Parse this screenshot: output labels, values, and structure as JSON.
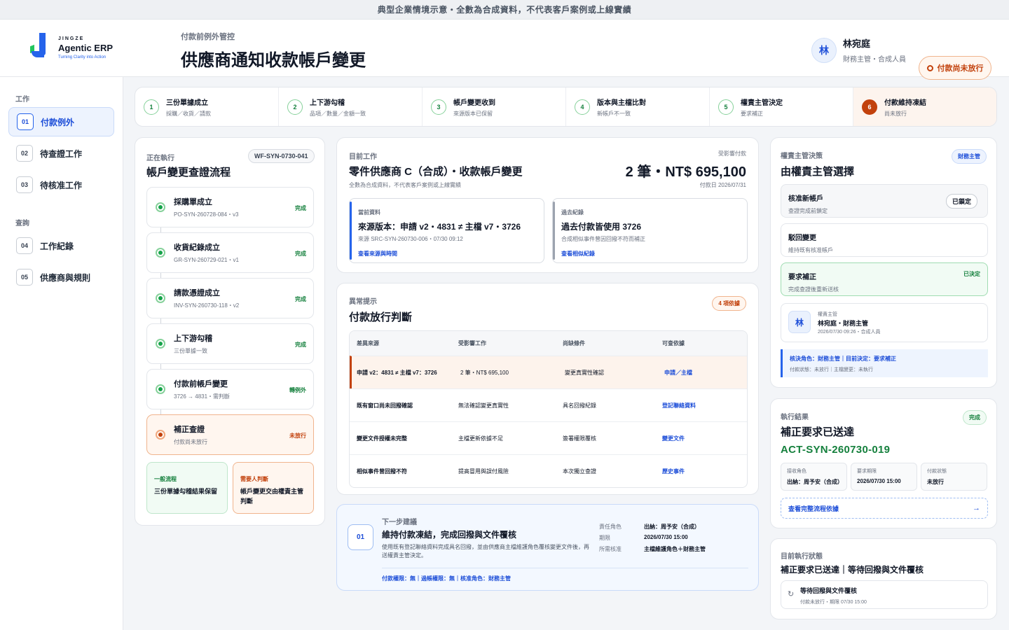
{
  "banner": "典型企業情境示意・全數為合成資料，不代表客戶案例或上線實績",
  "logo": {
    "small": "JINGZE",
    "brand": "Agentic ERP",
    "tagline": "Turning Clarity into Action"
  },
  "header": {
    "subtitle": "付款前例外管控",
    "title": "供應商通知收款帳戶變更"
  },
  "user": {
    "initial": "林",
    "name": "林宛庭",
    "role": "財務主管・合成人員",
    "status": "付款尚未放行"
  },
  "sidebar": {
    "section_work": "工作",
    "section_query": "查詢",
    "items": [
      {
        "num": "01",
        "label": "付款例外"
      },
      {
        "num": "02",
        "label": "待查證工作"
      },
      {
        "num": "03",
        "label": "待核准工作"
      },
      {
        "num": "04",
        "label": "工作紀錄"
      },
      {
        "num": "05",
        "label": "供應商與規則"
      }
    ]
  },
  "steps": [
    {
      "num": "1",
      "title": "三份單據成立",
      "sub": "採購／收貨／請款"
    },
    {
      "num": "2",
      "title": "上下游勾稽",
      "sub": "品項／數量／金額一致"
    },
    {
      "num": "3",
      "title": "帳戶變更收到",
      "sub": "來源版本已保留"
    },
    {
      "num": "4",
      "title": "版本與主檔比對",
      "sub": "新帳戶不一致"
    },
    {
      "num": "5",
      "title": "權責主管決定",
      "sub": "要求補正"
    },
    {
      "num": "6",
      "title": "付款維持凍結",
      "sub": "尚未放行"
    }
  ],
  "flow": {
    "label": "正在執行",
    "title": "帳戶變更查證流程",
    "id": "WF-SYN-0730-041",
    "items": [
      {
        "title": "採購單成立",
        "sub": "PO-SYN-260728-084・v3",
        "status": "完成"
      },
      {
        "title": "收貨紀錄成立",
        "sub": "GR-SYN-260729-021・v1",
        "status": "完成"
      },
      {
        "title": "請款憑證成立",
        "sub": "INV-SYN-260730-118・v2",
        "status": "完成"
      },
      {
        "title": "上下游勾稽",
        "sub": "三份單據一致",
        "status": "完成"
      },
      {
        "title": "付款前帳戶變更",
        "sub": "3726 → 4831・需判斷",
        "status": "轉例外"
      },
      {
        "title": "補正查證",
        "sub": "付款尚未放行",
        "status": "未放行"
      }
    ],
    "general": {
      "title": "一般流程",
      "body": "三份單據勾稽結果保留"
    },
    "human": {
      "title": "需要人判斷",
      "body": "帳戶變更交由權責主管判斷"
    }
  },
  "task": {
    "label": "目前工作",
    "title": "零件供應商 C（合成）・收款帳戶變更",
    "note": "全數為合成資料，不代表客戶案例或上線實績",
    "affected_label": "受影響付款",
    "amount": "2 筆・NT$ 695,100",
    "pay_date": "付款日 2026/07/31",
    "current": {
      "label": "當前資料",
      "title": "來源版本：申請 v2・4831 ≠ 主檔 v7・3726",
      "sub": "來源 SRC-SYN-260730-006・07/30 09:12",
      "link": "查看來源與時間"
    },
    "past": {
      "label": "過去紀錄",
      "title": "過去付款皆使用 3726",
      "sub": "合成相似事件曾因回撥不符而補正",
      "link": "查看相似紀錄"
    }
  },
  "anomaly": {
    "label": "異常提示",
    "title": "付款放行判斷",
    "badge": "4 項依據",
    "headers": [
      "差異來源",
      "受影響工作",
      "尚缺條件",
      "可查依據"
    ],
    "rows": [
      [
        "申請 v2：4831 ≠ 主檔 v7：3726",
        "2 筆・NT$ 695,100",
        "變更真實性確認",
        "申請／主檔"
      ],
      [
        "既有窗口尚未回撥確認",
        "無法確認變更真實性",
        "具名回撥紀錄",
        "登記聯絡資料"
      ],
      [
        "變更文件授權未完整",
        "主檔更新依據不足",
        "簽署權限覆核",
        "變更文件"
      ],
      [
        "相似事件曾回撥不符",
        "提高冒用與誤付風險",
        "本次獨立查證",
        "歷史事件"
      ]
    ]
  },
  "next": {
    "num": "01",
    "label": "下一步建議",
    "title": "維持付款凍結，完成回撥與文件覆核",
    "desc": "使用既有登記聯絡資料完成具名回撥，並由供應商主檔維護角色覆核變更文件後，再送權責主管決定。",
    "footer": "付款權限：無｜過帳權限：無｜核准角色：財務主管",
    "meta": [
      {
        "k": "責任角色",
        "v": "出納：周予安（合成）"
      },
      {
        "k": "期限",
        "v": "2026/07/30 15:00"
      },
      {
        "k": "所需核准",
        "v": "主檔維護角色＋財務主管"
      }
    ]
  },
  "decision": {
    "label": "權責主管決策",
    "title": "由權責主管選擇",
    "badge": "財務主管",
    "options": [
      {
        "title": "核准新帳戶",
        "sub": "查證完成前鎖定",
        "tag": "已鎖定"
      },
      {
        "title": "駁回變更",
        "sub": "維持既有核准帳戶",
        "tag": ""
      },
      {
        "title": "要求補正",
        "sub": "完成查證後重新送核",
        "tag": "已決定"
      }
    ],
    "approver": {
      "initial": "林",
      "label": "權責主管",
      "name": "林宛庭・財務主管",
      "time": "2026/07/30 09:26・合成人員"
    },
    "summary": "核決角色：財務主管｜目前決定：要求補正",
    "summary_sub": "付款狀態：未放行｜主檔變更：未執行"
  },
  "result": {
    "label": "執行結果",
    "title": "補正要求已送達",
    "badge": "完成",
    "code": "ACT-SYN-260730-019",
    "cells": [
      {
        "k": "接收角色",
        "v": "出納：周予安（合成）"
      },
      {
        "k": "要求期限",
        "v": "2026/07/30 15:00"
      },
      {
        "k": "付款狀態",
        "v": "未放行"
      }
    ],
    "link": "查看完整流程依據"
  },
  "exec": {
    "label": "目前執行狀態",
    "title": "補正要求已送達｜等待回撥與文件覆核",
    "item_title": "等待回撥與文件覆核",
    "item_sub": "付款未放行・期限 07/30 15:00"
  },
  "colors": {
    "accent": "#2563eb",
    "warn": "#c2410c",
    "ok": "#15803d"
  }
}
